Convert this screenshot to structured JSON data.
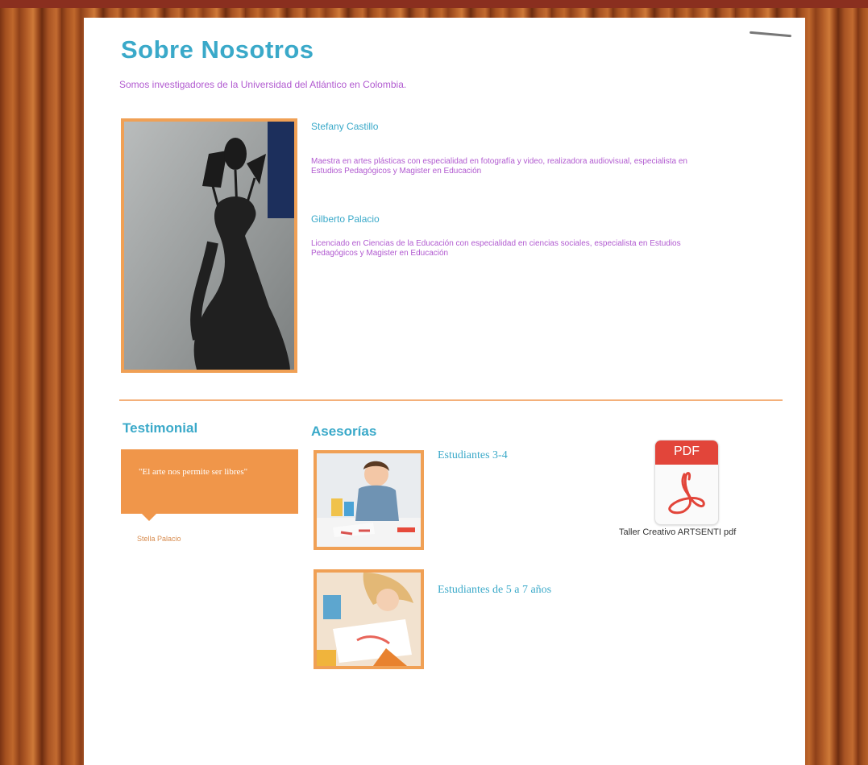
{
  "about": {
    "title": "Sobre Nosotros",
    "intro": "Somos investigadores de la Universidad del Atlántico en Colombia."
  },
  "team": [
    {
      "name": "Stefany Castillo",
      "description": "Maestra en artes plásticas con especialidad en fotografía y video, realizadora audiovisual, especialista en Estudios Pedagógicos y Magister en Educación"
    },
    {
      "name": "Gilberto Palacio",
      "description": "Licenciado en Ciencias de la Educación con especialidad en ciencias sociales, especialista en Estudios Pedagógicos y Magister en Educación"
    }
  ],
  "testimonial": {
    "heading": "Testimonial",
    "quote": "\"El arte nos permite ser libres\"",
    "author": "Stella Palacio"
  },
  "advisories": {
    "heading": "Asesorías",
    "items": [
      {
        "label": "Estudiantes 3-4"
      },
      {
        "label": "Estudiantes de 5 a 7 años"
      }
    ],
    "pdf": {
      "icon_label": "PDF",
      "filename": "Taller Creativo ARTSENTI pdf"
    }
  },
  "colors": {
    "accent_blue": "#3aa9c9",
    "accent_purple": "#b15ad0",
    "accent_orange": "#f0964a",
    "pdf_red": "#e2453a"
  }
}
